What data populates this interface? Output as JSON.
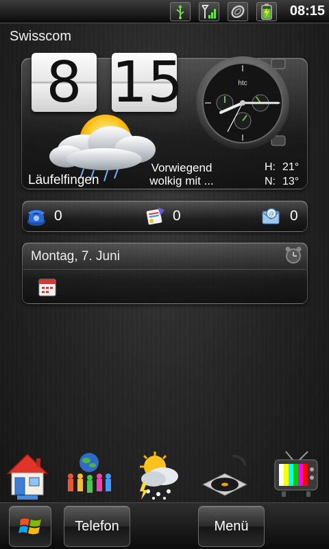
{
  "status_bar": {
    "time": "08:15",
    "icons": [
      "usb-icon",
      "signal-icon",
      "data-sync-icon",
      "battery-charging-icon"
    ]
  },
  "carrier": "Swisscom",
  "clock": {
    "hours": "8",
    "minutes": "15"
  },
  "weather": {
    "city": "Läufelfingen",
    "condition_line1": "Vorwiegend",
    "condition_line2": "wolkig mit ...",
    "high_label": "H:",
    "high": "21°",
    "low_label": "N:",
    "low": "13°",
    "icon": "partly-cloudy-rain-icon"
  },
  "analog_clock": {
    "brand": "htc",
    "hour": 8,
    "minute": 15
  },
  "comms": {
    "calls": "0",
    "sms": "0",
    "email": "0"
  },
  "calendar": {
    "date": "Montag, 7. Juni"
  },
  "dock": [
    "home-icon",
    "people-icon",
    "weather-icon",
    "music-icon",
    "tv-icon"
  ],
  "bottom_bar": {
    "start": "windows-start-icon",
    "phone_label": "Telefon",
    "menu_label": "Menü"
  },
  "colors": {
    "accent_green": "#5ec832",
    "wood_dark": "#1c1c1c"
  }
}
